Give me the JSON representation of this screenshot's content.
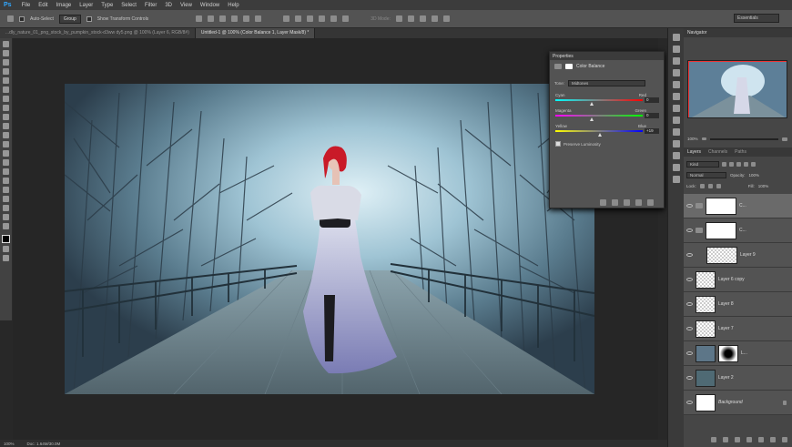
{
  "menu": {
    "logo": "Ps",
    "items": [
      "File",
      "Edit",
      "Image",
      "Layer",
      "Type",
      "Select",
      "Filter",
      "3D",
      "View",
      "Window",
      "Help"
    ]
  },
  "options": {
    "auto_select_label": "Auto-Select",
    "auto_select_value": "Group",
    "transform_label": "Show Transform Controls",
    "mode_3d": "3D Mode:",
    "workspace": "Essentials"
  },
  "tabs": [
    {
      "label": "...dly_nature_01_png_stock_by_pumpkin_stock-d3ww dy5.png @ 100% (Layer 6, RGB/8#)"
    },
    {
      "label": "Untitled-1 @ 100% (Color Balance 1, Layer Mask/8) *"
    }
  ],
  "status": {
    "zoom": "100%",
    "doc": "Doc: 1.64M/30.0M"
  },
  "properties": {
    "title": "Properties",
    "panel": "Color Balance",
    "tone_label": "Tone:",
    "tone_value": "Midtones",
    "sliders": [
      {
        "left": "Cyan",
        "right": "Red",
        "value": "0"
      },
      {
        "left": "Magenta",
        "right": "Green",
        "value": "0"
      },
      {
        "left": "Yellow",
        "right": "Blue",
        "value": "+19"
      }
    ],
    "preserve_label": "Preserve Luminosity"
  },
  "navigator": {
    "tabs": [
      "Navigator"
    ],
    "zoom": "100%"
  },
  "layers": {
    "tabs": [
      "Layers",
      "Channels",
      "Paths"
    ],
    "kind": "Kind",
    "blend": "Normal",
    "opacity_label": "Opacity:",
    "opacity": "100%",
    "lock_label": "Lock:",
    "fill_label": "Fill:",
    "fill": "100%",
    "items": [
      {
        "name": "C...",
        "type": "adjust-balance"
      },
      {
        "name": "C...",
        "type": "adjust-curves"
      },
      {
        "name": "Layer 9",
        "type": "checker"
      },
      {
        "name": "Layer 6 copy",
        "type": "girl"
      },
      {
        "name": "Layer 8",
        "type": "checker"
      },
      {
        "name": "Layer 7",
        "type": "checker"
      },
      {
        "name": "L...",
        "type": "photo-mask"
      },
      {
        "name": "Layer 2",
        "type": "photo"
      },
      {
        "name": "Background",
        "type": "white"
      }
    ]
  }
}
